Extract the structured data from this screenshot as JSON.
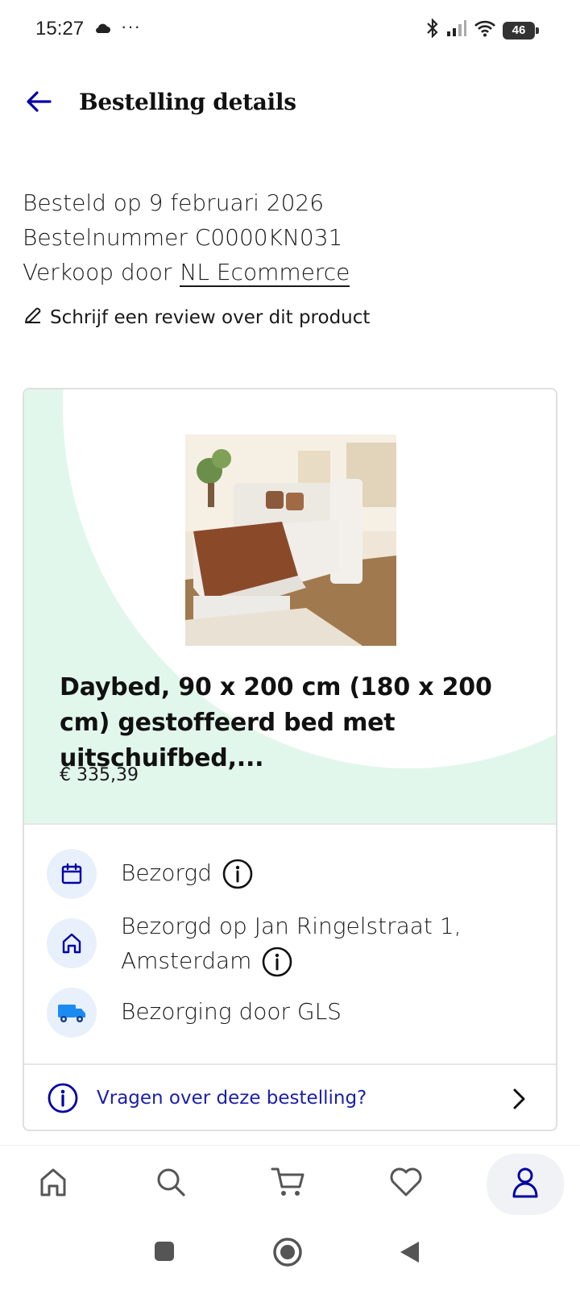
{
  "status_bar": {
    "time": "15:27",
    "dots": "···",
    "battery": "46",
    "icons": [
      "cloud-icon",
      "bluetooth-icon",
      "signal-icon",
      "wifi-icon",
      "battery-icon"
    ]
  },
  "header": {
    "title": "Bestelling details",
    "back_icon": "arrow-left-icon"
  },
  "order": {
    "ordered_on": "Besteld op 9 februari 2026",
    "order_number": "Bestelnummer C0000KN031",
    "sold_by_label": "Verkoop door",
    "seller": "NL Ecommerce"
  },
  "review": {
    "label": "Schrijf een review over dit product",
    "icon": "pencil-icon"
  },
  "product": {
    "title": "Daybed, 90 x 200 cm (180 x 200 cm) gestoffeerd bed met uitschuifbed,...",
    "price": "€ 335,39",
    "image_alt": "daybed-photo"
  },
  "delivery": {
    "status": "Bezorgd",
    "address_line1": "Bezorgd op Jan Ringelstraat 1,",
    "address_line2": "Amsterdam",
    "carrier": "Bezorging door GLS"
  },
  "help": {
    "label": "Vragen over deze bestelling?"
  },
  "bottom_nav": {
    "items": [
      "home",
      "search",
      "cart",
      "favorites",
      "account"
    ],
    "active": "account"
  },
  "colors": {
    "accent": "#0000a4",
    "hero_bg": "#e2f7ec",
    "icon_circle": "#e8f0fb",
    "truck": "#1b8bf2"
  }
}
